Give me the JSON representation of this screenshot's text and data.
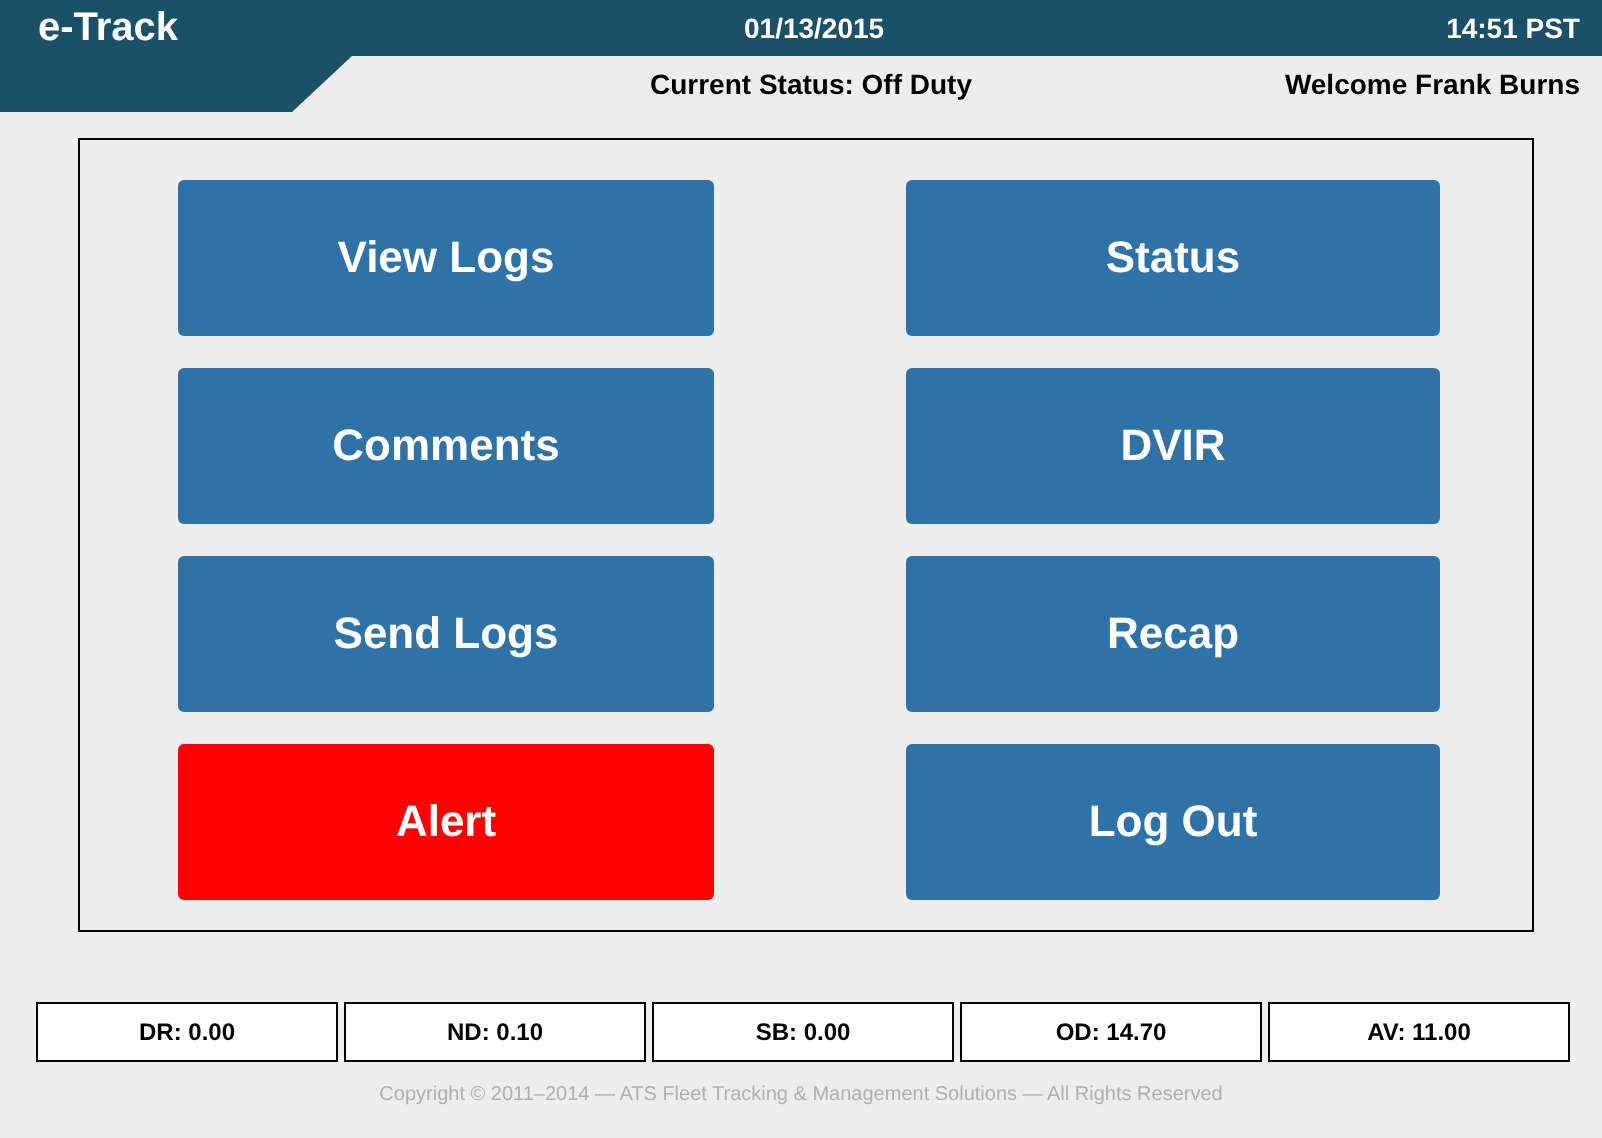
{
  "header": {
    "app_name": "e-Track",
    "date": "01/13/2015",
    "time": "14:51 PST",
    "status": "Current Status: Off Duty",
    "welcome": "Welcome Frank Burns"
  },
  "menu_buttons": [
    {
      "label": "View Logs",
      "kind": "normal"
    },
    {
      "label": "Status",
      "kind": "normal"
    },
    {
      "label": "Comments",
      "kind": "normal"
    },
    {
      "label": "DVIR",
      "kind": "normal"
    },
    {
      "label": "Send Logs",
      "kind": "normal"
    },
    {
      "label": "Recap",
      "kind": "normal"
    },
    {
      "label": "Alert",
      "kind": "alert"
    },
    {
      "label": "Log Out",
      "kind": "normal"
    }
  ],
  "totals": [
    "DR: 0.00",
    "ND: 0.10",
    "SB: 0.00",
    "OD: 14.70",
    "AV: 11.00"
  ],
  "footer": "Copyright © 2011–2014 — ATS Fleet Tracking & Management Solutions — All Rights Reserved"
}
